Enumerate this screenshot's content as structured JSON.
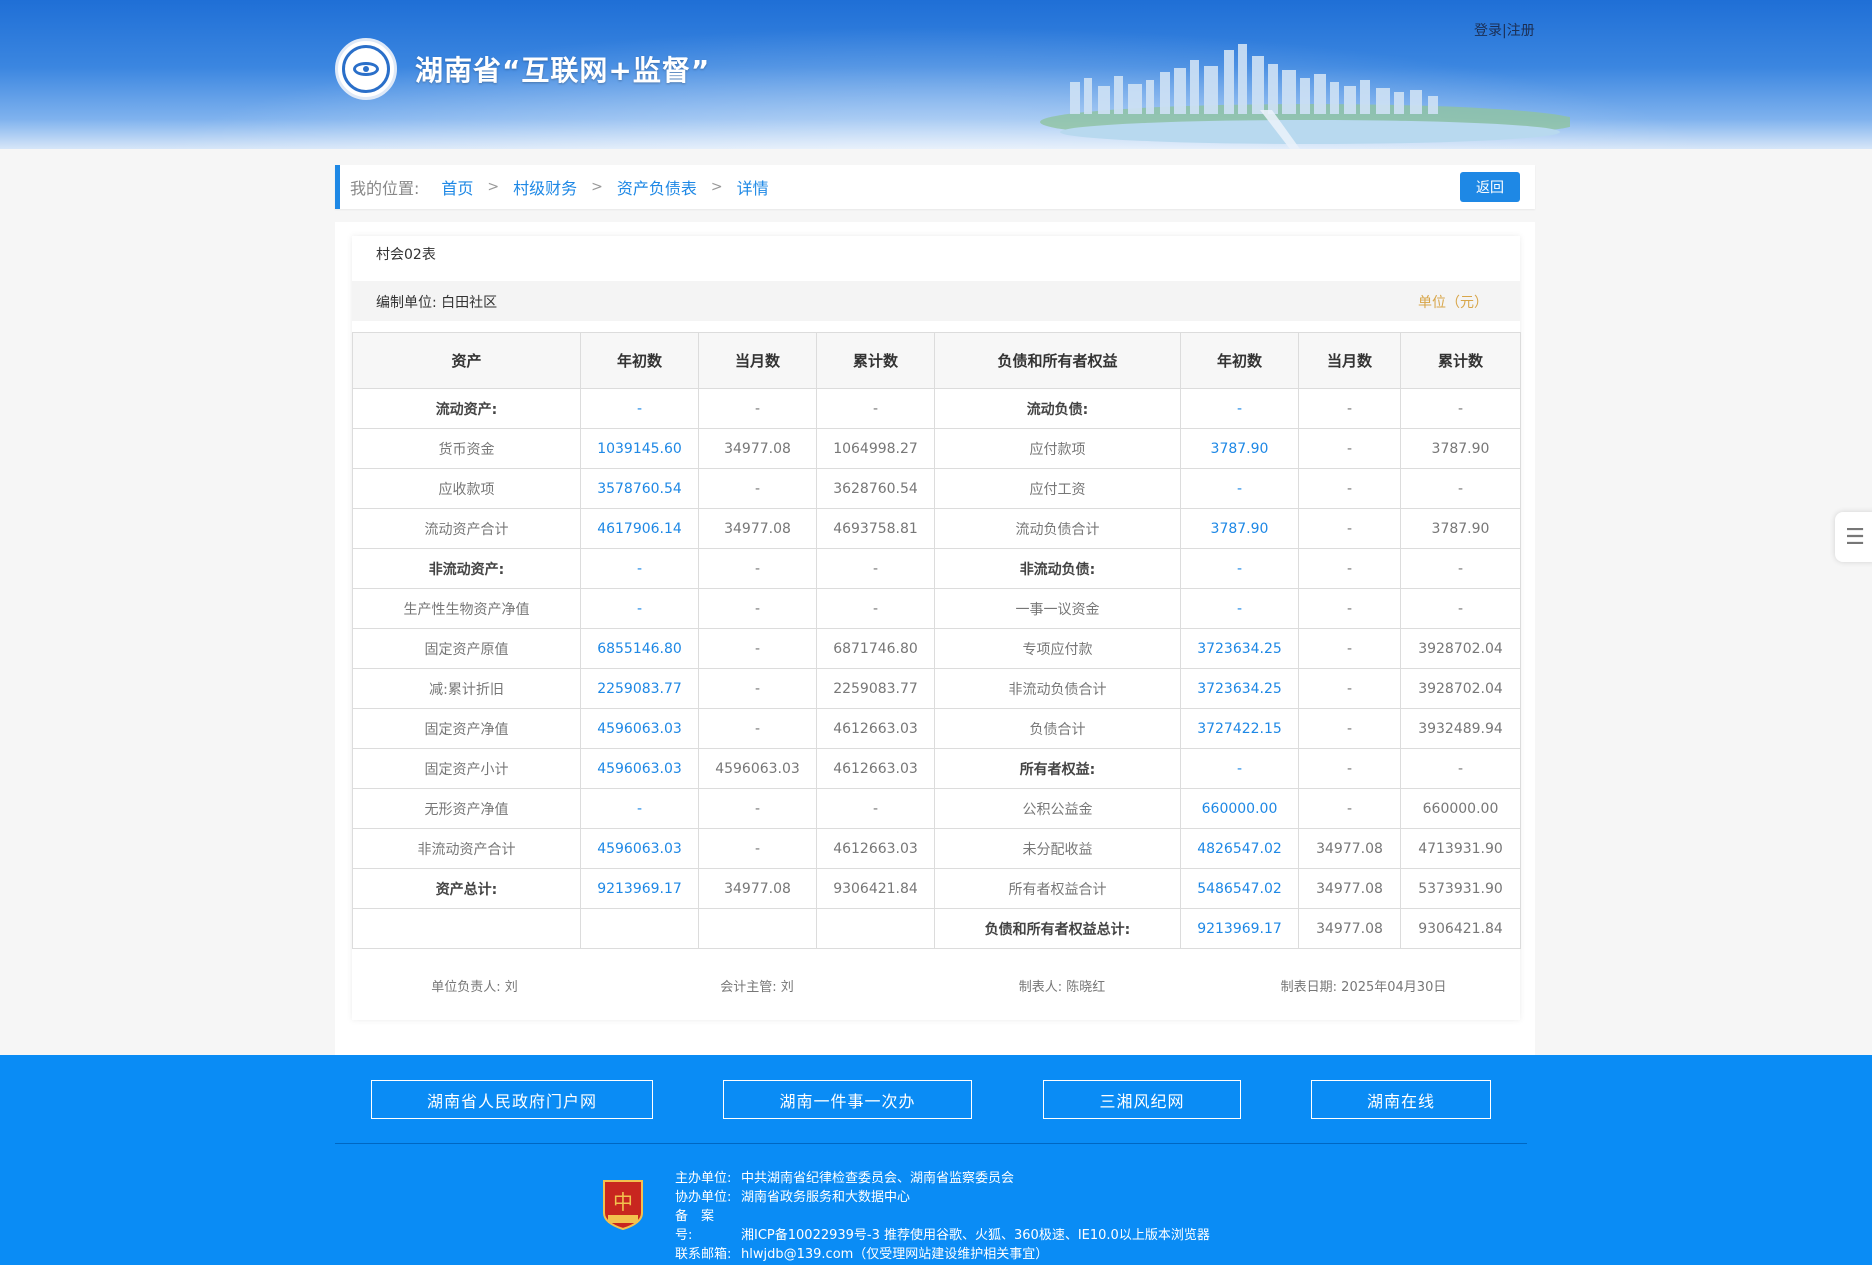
{
  "header": {
    "site_title": "湖南省“互联网+监督”",
    "login": "登录",
    "sep": "|",
    "register": "注册"
  },
  "breadcrumb": {
    "label": "我的位置:",
    "items": [
      "首页",
      "村级财务",
      "资产负债表",
      "详情"
    ],
    "sep": ">",
    "back": "返回"
  },
  "report": {
    "form_no": "村会02表",
    "org": "编制单位: 白田社区",
    "unit": "单位（元）",
    "headers": [
      "资产",
      "年初数",
      "当月数",
      "累计数",
      "负债和所有者权益",
      "年初数",
      "当月数",
      "累计数"
    ],
    "rows": [
      {
        "a": "流动资产:",
        "a_b": true,
        "a1": "-",
        "a2": "-",
        "a3": "-",
        "l": "流动负债:",
        "l_b": true,
        "l1": "-",
        "l2": "-",
        "l3": "-"
      },
      {
        "a": "货币资金",
        "a1": "1039145.60",
        "a2": "34977.08",
        "a3": "1064998.27",
        "l": "应付款项",
        "l1": "3787.90",
        "l2": "-",
        "l3": "3787.90"
      },
      {
        "a": "应收款项",
        "a1": "3578760.54",
        "a2": "-",
        "a3": "3628760.54",
        "l": "应付工资",
        "l1": "-",
        "l2": "-",
        "l3": "-"
      },
      {
        "a": "流动资产合计",
        "a1": "4617906.14",
        "a2": "34977.08",
        "a3": "4693758.81",
        "l": "流动负债合计",
        "l1": "3787.90",
        "l2": "-",
        "l3": "3787.90"
      },
      {
        "a": "非流动资产:",
        "a_b": true,
        "a1": "-",
        "a2": "-",
        "a3": "-",
        "l": "非流动负债:",
        "l_b": true,
        "l1": "-",
        "l2": "-",
        "l3": "-"
      },
      {
        "a": "生产性生物资产净值",
        "a1": "-",
        "a2": "-",
        "a3": "-",
        "l": "一事一议资金",
        "l1": "-",
        "l2": "-",
        "l3": "-"
      },
      {
        "a": "固定资产原值",
        "a1": "6855146.80",
        "a2": "-",
        "a3": "6871746.80",
        "l": "专项应付款",
        "l1": "3723634.25",
        "l2": "-",
        "l3": "3928702.04"
      },
      {
        "a": "减:累计折旧",
        "a1": "2259083.77",
        "a2": "-",
        "a3": "2259083.77",
        "l": "非流动负债合计",
        "l1": "3723634.25",
        "l2": "-",
        "l3": "3928702.04"
      },
      {
        "a": "固定资产净值",
        "a1": "4596063.03",
        "a2": "-",
        "a3": "4612663.03",
        "l": "负债合计",
        "l1": "3727422.15",
        "l2": "-",
        "l3": "3932489.94"
      },
      {
        "a": "固定资产小计",
        "a1": "4596063.03",
        "a2": "4596063.03",
        "a3": "4612663.03",
        "l": "所有者权益:",
        "l_b": true,
        "l1": "-",
        "l2": "-",
        "l3": "-"
      },
      {
        "a": "无形资产净值",
        "a1": "-",
        "a2": "-",
        "a3": "-",
        "l": "公积公益金",
        "l1": "660000.00",
        "l2": "-",
        "l3": "660000.00"
      },
      {
        "a": "非流动资产合计",
        "a1": "4596063.03",
        "a2": "-",
        "a3": "4612663.03",
        "l": "未分配收益",
        "l1": "4826547.02",
        "l2": "34977.08",
        "l3": "4713931.90"
      },
      {
        "a": "资产总计:",
        "a_b": true,
        "a1": "9213969.17",
        "a2": "34977.08",
        "a3": "9306421.84",
        "l": "所有者权益合计",
        "l1": "5486547.02",
        "l2": "34977.08",
        "l3": "5373931.90"
      },
      {
        "a": "",
        "a1": "",
        "a2": "",
        "a3": "",
        "l": "负债和所有者权益总计:",
        "l_b": true,
        "l1": "9213969.17",
        "l2": "34977.08",
        "l3": "9306421.84"
      }
    ],
    "signs": {
      "head": "单位负责人: 刘",
      "accountant": "会计主管: 刘",
      "maker": "制表人: 陈晓红",
      "date": "制表日期: 2025年04月30日"
    }
  },
  "footer": {
    "links": [
      "湖南省人民政府门户网",
      "湖南一件事一次办",
      "三湘风纪网",
      "湖南在线"
    ],
    "badge_text": "党政机关",
    "info": [
      {
        "k": "主办单位:",
        "v": "中共湖南省纪律检查委员会、湖南省监察委员会"
      },
      {
        "k": "协办单位:",
        "v": "湖南省政务服务和大数据中心"
      },
      {
        "k": "备　案　号:",
        "v": "湘ICP备10022939号-3   推荐使用谷歌、火狐、360极速、IE10.0以上版本浏览器"
      },
      {
        "k": "联系邮箱:",
        "v": "hlwjdb@139.com（仅受理网站建设维护相关事宜）"
      }
    ]
  },
  "colors": {
    "brand_blue": "#1e88e5",
    "footer_blue": "#0a8cf5",
    "unit_gold": "#d8a64a"
  },
  "icons": {
    "side_tool": "menu-collapse-icon",
    "logo": "eye-logo-icon"
  }
}
